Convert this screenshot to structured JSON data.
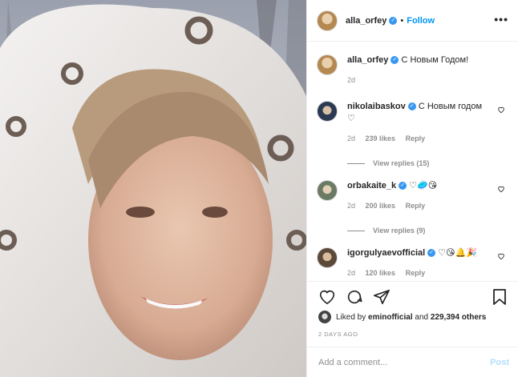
{
  "header": {
    "username": "alla_orfey",
    "separator": "•",
    "follow_label": "Follow",
    "more_label": "•••"
  },
  "caption": {
    "username": "alla_orfey",
    "text": "С Новым Годом!",
    "time": "2d"
  },
  "comments": [
    {
      "username": "nikolaibaskov",
      "text": "С Новым годом ♡",
      "time": "2d",
      "likes": "239 likes",
      "reply": "Reply",
      "view_replies": "View replies (15)"
    },
    {
      "username": "orbakaite_k",
      "text": "♡🥏😘",
      "time": "2d",
      "likes": "200 likes",
      "reply": "Reply",
      "view_replies": "View replies (9)"
    },
    {
      "username": "igorgulyaevofficial",
      "text": "♡😘🔔🎉",
      "time": "2d",
      "likes": "120 likes",
      "reply": "Reply"
    }
  ],
  "likes_line": {
    "prefix": "Liked by",
    "user": "eminofficial",
    "middle": "and",
    "count": "229,394 others"
  },
  "timestamp": "2 DAYS AGO",
  "comment_box": {
    "placeholder": "Add a comment...",
    "post_label": "Post"
  },
  "colors": {
    "accent": "#0095f6",
    "verified": "#3897f0",
    "muted": "#8e8e8e",
    "post_disabled": "#b2dffc"
  }
}
